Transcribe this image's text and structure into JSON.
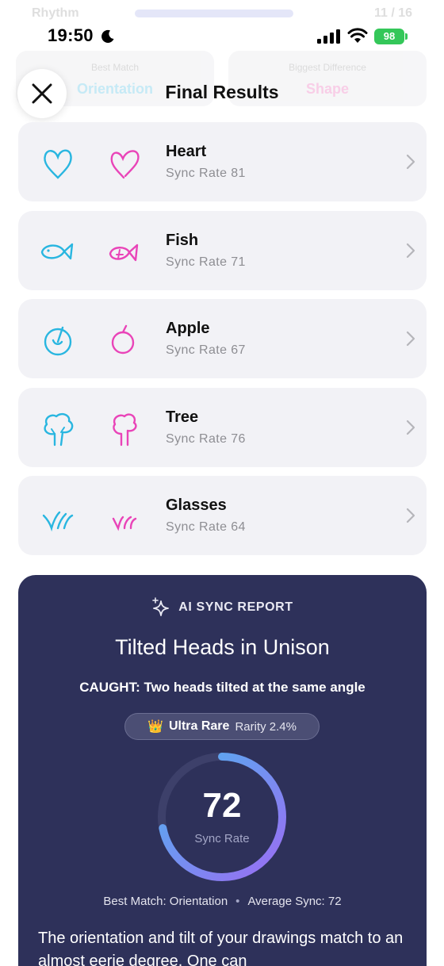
{
  "background": {
    "title": "Rhythm",
    "count": "11 / 16",
    "left_tab": {
      "label": "Best Match",
      "value": "Orientation"
    },
    "right_tab": {
      "label": "Biggest Difference",
      "value": "Shape"
    }
  },
  "status_bar": {
    "time": "19:50",
    "battery": "98"
  },
  "header": {
    "title": "Final Results"
  },
  "results": [
    {
      "name": "Heart",
      "sync": "Sync Rate 81"
    },
    {
      "name": "Fish",
      "sync": "Sync Rate 71"
    },
    {
      "name": "Apple",
      "sync": "Sync Rate 67"
    },
    {
      "name": "Tree",
      "sync": "Sync Rate 76"
    },
    {
      "name": "Glasses",
      "sync": "Sync Rate 64"
    }
  ],
  "report": {
    "header_label": "AI SYNC REPORT",
    "title": "Tilted Heads in Unison",
    "caught": "CAUGHT: Two heads tilted at the same angle",
    "rarity_label": "Ultra Rare",
    "rarity_value": "Rarity 2.4%",
    "score": "72",
    "score_label": "Sync Rate",
    "score_fraction": 0.72,
    "best_match": "Best Match: Orientation",
    "average": "Average Sync: 72",
    "body": "The orientation and tilt of your drawings match to an almost eerie degree. One can"
  },
  "colors": {
    "drawing_a": "#29b6e0",
    "drawing_b": "#e944b8",
    "report_bg": "#2e315a",
    "gauge_start": "#e3479e",
    "gauge_mid": "#5aa9f0",
    "gauge_end": "#9b6cf2"
  },
  "icons": {
    "close": "close-icon",
    "chevron": "chevron-right-icon",
    "sparkle": "sparkle-icon",
    "crown": "crown-icon"
  }
}
